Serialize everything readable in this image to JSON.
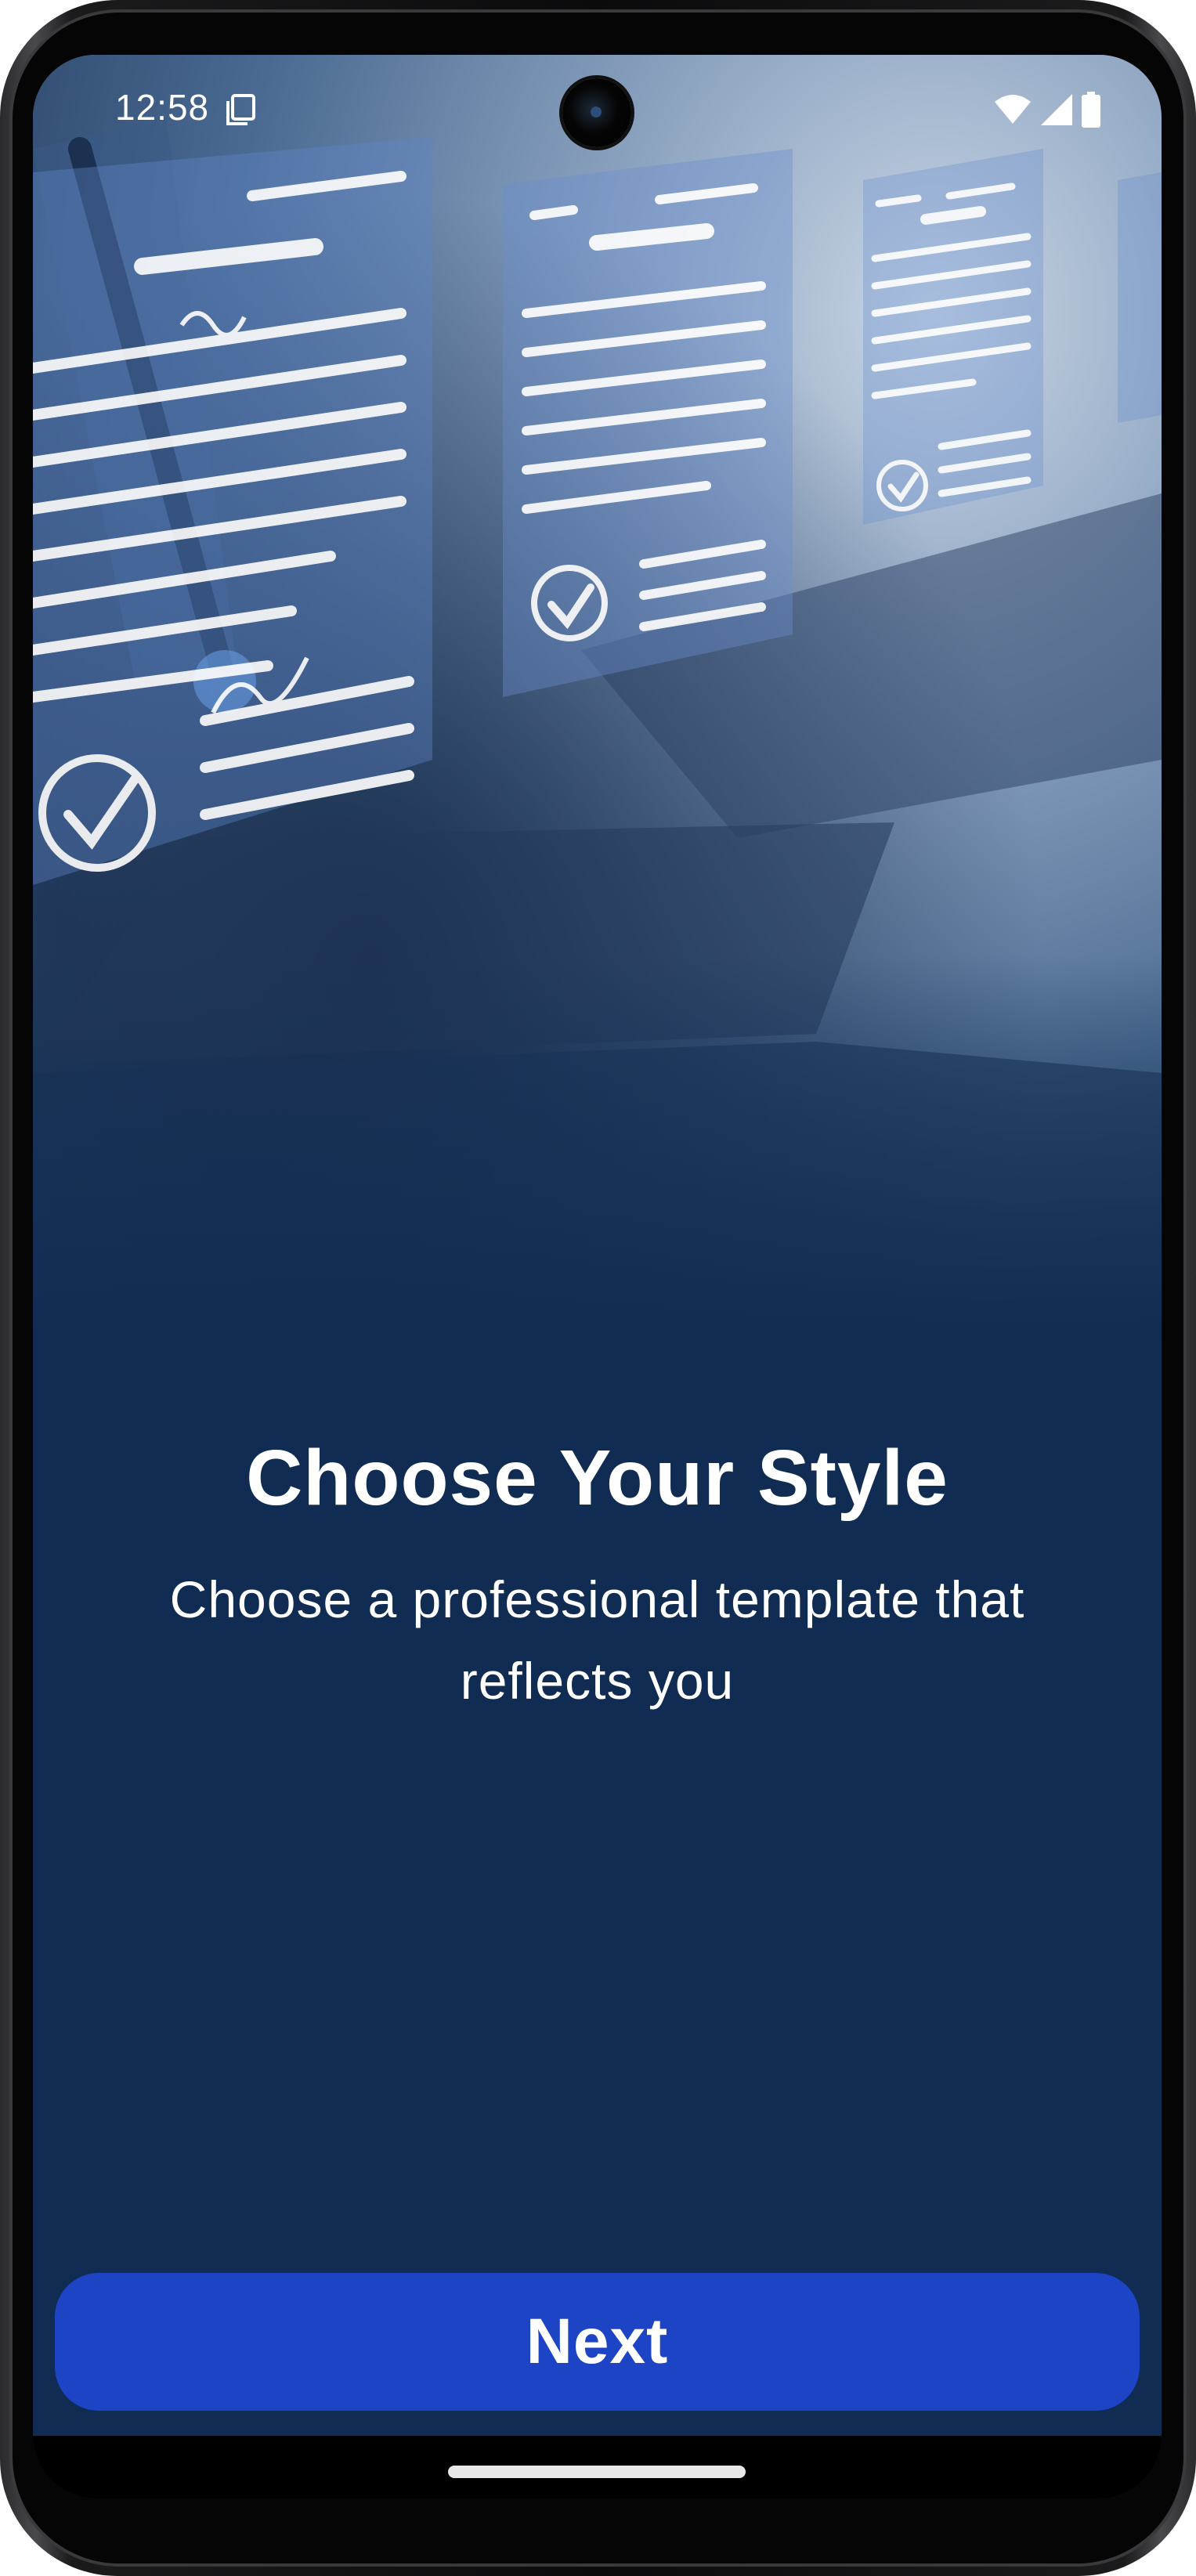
{
  "status_bar": {
    "time": "12:58",
    "icons": [
      "screen-record-icon",
      "wifi-icon",
      "cellular-signal-icon",
      "battery-icon"
    ]
  },
  "onboarding": {
    "title": "Choose Your Style",
    "subtitle_line1": "Choose a professional template that",
    "subtitle_line2": "reflects you",
    "next_label": "Next"
  },
  "colors": {
    "background": "#102c52",
    "button": "#1c44c4",
    "text": "#ffffff"
  }
}
